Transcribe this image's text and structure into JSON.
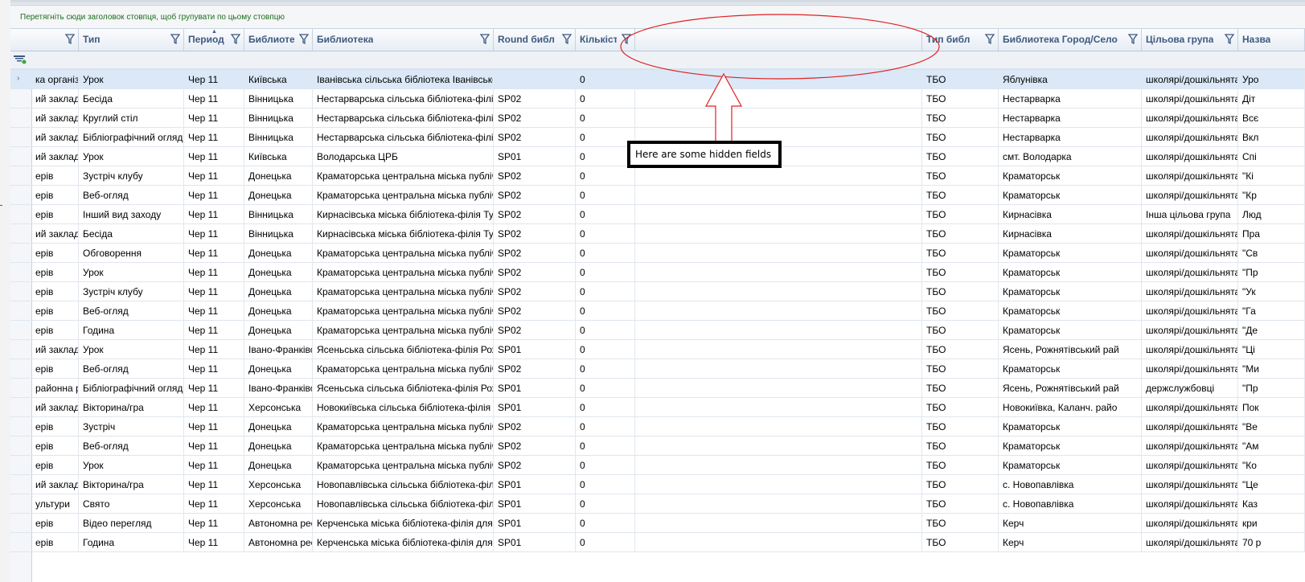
{
  "group_panel_hint": "Перетягніть сюди заголовок стовпця, щоб групувати по цьому стовпцю",
  "annotation": "Here are some hidden fields",
  "columns": [
    {
      "label": ""
    },
    {
      "label": "Тип"
    },
    {
      "label": "Период"
    },
    {
      "label": "Библиотека"
    },
    {
      "label": "Библиотека"
    },
    {
      "label": "Round библ"
    },
    {
      "label": "Кількість"
    },
    {
      "label": ""
    },
    {
      "label": "Тип библ"
    },
    {
      "label": "Библиотека Город/Село"
    },
    {
      "label": "Цільова група"
    },
    {
      "label": "Назва"
    }
  ],
  "rows": [
    [
      "ка організа",
      "Урок",
      "Чер 11",
      "Київська",
      "Іванівська сільська бібліотека Іванівсько",
      "",
      "0",
      "",
      "ТБО",
      "Яблунівка",
      "школярі/дошкільнята",
      "Уро"
    ],
    [
      "ий заклад",
      "Бесіда",
      "Чер 11",
      "Вінницька",
      "Нестарварська сільська бібліотека-філія",
      "SP02",
      "0",
      "",
      "ТБО",
      "Нестарварка",
      "школярі/дошкільнята",
      "Діт"
    ],
    [
      "ий заклад",
      "Круглий стіл",
      "Чер 11",
      "Вінницька",
      "Нестарварська сільська бібліотека-філія",
      "SP02",
      "0",
      "",
      "ТБО",
      "Нестарварка",
      "школярі/дошкільнята",
      "Всє"
    ],
    [
      "ий заклад",
      "Бібліографічний огляд",
      "Чер 11",
      "Вінницька",
      "Нестарварська сільська бібліотека-філія",
      "SP02",
      "0",
      "",
      "ТБО",
      "Нестарварка",
      "школярі/дошкільнята",
      "Вкл"
    ],
    [
      "ий заклад",
      "Урок",
      "Чер 11",
      "Київська",
      "Володарська ЦРБ",
      "SP01",
      "0",
      "",
      "ТБО",
      "смт. Володарка",
      "школярі/дошкільнята",
      "Спі"
    ],
    [
      "ерів",
      "Зустріч клубу",
      "Чер 11",
      "Донецька",
      "Краматорська центральна міська публічна",
      "SP02",
      "0",
      "",
      "ТБО",
      "Краматорськ",
      "школярі/дошкільнята",
      "\"Кі"
    ],
    [
      "ерів",
      "Веб-огляд",
      "Чер 11",
      "Донецька",
      "Краматорська центральна міська публічна",
      "SP02",
      "0",
      "",
      "ТБО",
      "Краматорськ",
      "школярі/дошкільнята",
      "\"Кр"
    ],
    [
      "ерів",
      "Інший вид заходу",
      "Чер 11",
      "Вінницька",
      "Кирнасівська міська бібліотека-філія Тул",
      "SP02",
      "0",
      "",
      "ТБО",
      "Кирнасівка",
      "Інша цільова група",
      "Люд"
    ],
    [
      "ий заклад",
      "Бесіда",
      "Чер 11",
      "Вінницька",
      "Кирнасівська міська бібліотека-філія Тул",
      "SP02",
      "0",
      "",
      "ТБО",
      "Кирнасівка",
      "школярі/дошкільнята",
      "Пра"
    ],
    [
      "ерів",
      "Обговорення",
      "Чер 11",
      "Донецька",
      "Краматорська центральна міська публічна",
      "SP02",
      "0",
      "",
      "ТБО",
      "Краматорськ",
      "школярі/дошкільнята",
      "\"Св"
    ],
    [
      "ерів",
      "Урок",
      "Чер 11",
      "Донецька",
      "Краматорська центральна міська публічна",
      "SP02",
      "0",
      "",
      "ТБО",
      "Краматорськ",
      "школярі/дошкільнята",
      "\"Пр"
    ],
    [
      "ерів",
      "Зустріч клубу",
      "Чер 11",
      "Донецька",
      "Краматорська центральна міська публічна",
      "SP02",
      "0",
      "",
      "ТБО",
      "Краматорськ",
      "школярі/дошкільнята",
      "\"Ук"
    ],
    [
      "ерів",
      "Веб-огляд",
      "Чер 11",
      "Донецька",
      "Краматорська центральна міська публічна",
      "SP02",
      "0",
      "",
      "ТБО",
      "Краматорськ",
      "школярі/дошкільнята",
      "\"Га"
    ],
    [
      "ерів",
      "Година",
      "Чер 11",
      "Донецька",
      "Краматорська центральна міська публічна",
      "SP02",
      "0",
      "",
      "ТБО",
      "Краматорськ",
      "школярі/дошкільнята",
      "\"Де"
    ],
    [
      "ий заклад",
      "Урок",
      "Чер 11",
      "Івано-Франківська",
      "Ясеньська сільська бібліотека-філія Рожн",
      "SP01",
      "0",
      "",
      "ТБО",
      "Ясень, Рожнятівський рай",
      "школярі/дошкільнята",
      "\"Ці"
    ],
    [
      "ерів",
      "Веб-огляд",
      "Чер 11",
      "Донецька",
      "Краматорська центральна міська публічна",
      "SP02",
      "0",
      "",
      "ТБО",
      "Краматорськ",
      "школярі/дошкільнята",
      "\"Ми"
    ],
    [
      "районна ра",
      "Бібліографічний огляд",
      "Чер 11",
      "Івано-Франківська",
      "Ясеньська сільська бібліотека-філія Рожн",
      "SP01",
      "0",
      "",
      "ТБО",
      "Ясень, Рожнятівський рай",
      "держслужбовці",
      "\"Пр"
    ],
    [
      "ий заклад",
      "Вікторина/гра",
      "Чер 11",
      "Херсонська",
      "Новокиївська сільська бібліотека-філія К",
      "SP01",
      "0",
      "",
      "ТБО",
      "Новокиївка, Каланч. райо",
      "школярі/дошкільнята",
      "Пок"
    ],
    [
      "ерів",
      "Зустріч",
      "Чер 11",
      "Донецька",
      "Краматорська центральна міська публічна",
      "SP02",
      "0",
      "",
      "ТБО",
      "Краматорськ",
      "школярі/дошкільнята",
      "\"Ве"
    ],
    [
      "ерів",
      "Веб-огляд",
      "Чер 11",
      "Донецька",
      "Краматорська центральна міська публічна",
      "SP02",
      "0",
      "",
      "ТБО",
      "Краматорськ",
      "школярі/дошкільнята",
      "\"Ам"
    ],
    [
      "ерів",
      "Урок",
      "Чер 11",
      "Донецька",
      "Краматорська центральна міська публічна",
      "SP02",
      "0",
      "",
      "ТБО",
      "Краматорськ",
      "школярі/дошкільнята",
      "\"Ко"
    ],
    [
      "ий заклад",
      "Вікторина/гра",
      "Чер 11",
      "Херсонська",
      "Новопавлівська сільська бібліотека-філія",
      "SP01",
      "0",
      "",
      "ТБО",
      "с. Новопавлівка",
      "школярі/дошкільнята",
      "\"Це"
    ],
    [
      "ультури",
      "Свято",
      "Чер 11",
      "Херсонська",
      "Новопавлівська сільська бібліотека-філія",
      "SP01",
      "0",
      "",
      "ТБО",
      "с. Новопавлівка",
      "школярі/дошкільнята",
      "Каз"
    ],
    [
      "ерів",
      "Відео перегляд",
      "Чер 11",
      "Автономна республіка",
      "Керченська міська бібліотека-філія для д",
      "SP01",
      "0",
      "",
      "ТБО",
      "Керч",
      "школярі/дошкільнята",
      "кри"
    ],
    [
      "ерів",
      "Година",
      "Чер 11",
      "Автономна республіка",
      "Керченська міська бібліотека-філія для д",
      "SP01",
      "0",
      "",
      "ТБО",
      "Керч",
      "школярі/дошкільнята",
      "70 р"
    ]
  ]
}
